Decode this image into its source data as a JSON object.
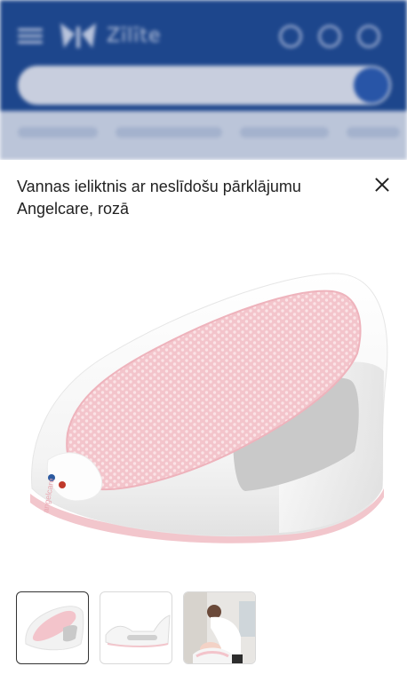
{
  "background": {
    "logo_text": "Zīlīte"
  },
  "product": {
    "title": "Vannas ieliktnis ar neslīdošu pārklājumu Angelcare, rozā",
    "accent_color": "#f6cdd3",
    "brand_on_product": "angelcare"
  },
  "thumbnails": [
    {
      "name": "thumbnail-bath-seat-angle",
      "active": true
    },
    {
      "name": "thumbnail-bath-seat-side",
      "active": false
    },
    {
      "name": "thumbnail-parent-with-baby",
      "active": false
    }
  ]
}
